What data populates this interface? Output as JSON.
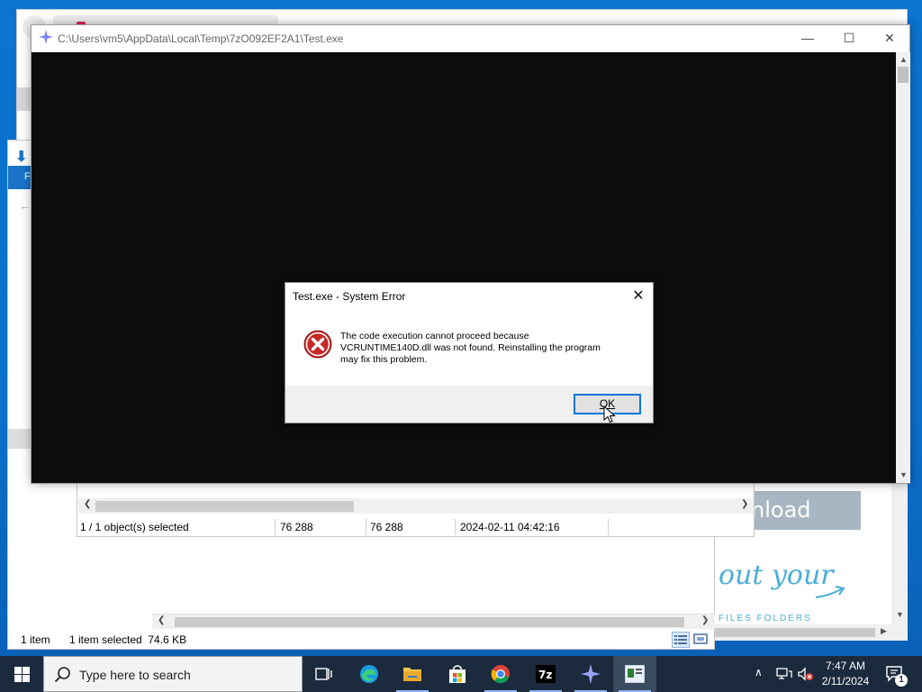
{
  "console_window": {
    "title": "C:\\Users\\vm5\\AppData\\Local\\Temp\\7zO092EF2A1\\Test.exe",
    "icon": "sparkle-icon"
  },
  "error_dialog": {
    "title": "Test.exe - System Error",
    "message_line1": "The code execution cannot proceed because",
    "message_line2": "VCRUNTIME140D.dll was not found. Reinstalling the program",
    "message_line3": "may fix this problem.",
    "ok_label": "OK",
    "icon": "error-icon"
  },
  "sevenzip_status": {
    "selection": "1 / 1 object(s) selected",
    "size": "76 288",
    "packed_size": "76 288",
    "modified": "2024-02-11 04:42:16"
  },
  "explorer_status": {
    "item_count": "1 item",
    "selected": "1 item selected  74.6 KB"
  },
  "background_page": {
    "download_text": "nload",
    "handwriting": "out your",
    "files_text": "FILES FOLDERS"
  },
  "taskbar": {
    "search_placeholder": "Type here to search",
    "apps": [
      "task-view",
      "edge",
      "file-explorer",
      "microsoft-store",
      "chrome",
      "7zip",
      "sparkle-app",
      "console-app"
    ],
    "time": "7:47 AM",
    "date": "2/11/2024",
    "notification_count": "1"
  },
  "colors": {
    "accent": "#0078d7",
    "desktop": "#0a74d0",
    "taskbar": "#1c2a3d",
    "console_bg": "#0c0c0c",
    "error_red": "#d32f2f"
  }
}
